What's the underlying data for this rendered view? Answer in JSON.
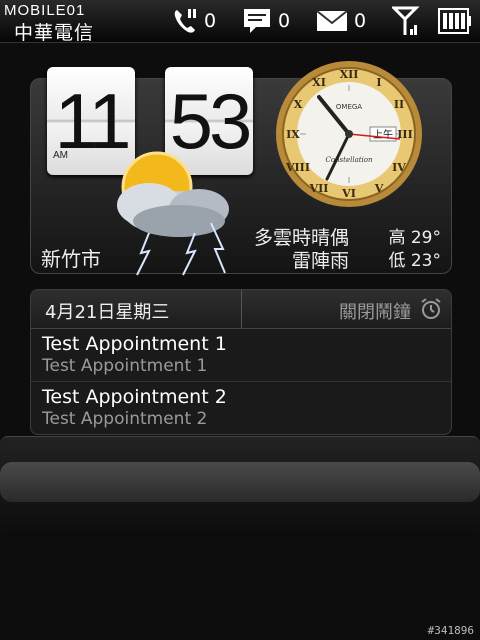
{
  "status_bar": {
    "watermark_brand": "MOBILE01",
    "carrier": "中華電信",
    "missed_calls": "0",
    "messages": "0",
    "emails": "0"
  },
  "clock": {
    "hour": "11",
    "minute": "53",
    "ampm": "AM",
    "analog_brand": "OMEGA",
    "analog_model": "Constellation",
    "analog_ampm": "上午"
  },
  "weather": {
    "city": "新竹市",
    "condition_line1": "多雲時晴偶",
    "condition_line2": "雷陣雨",
    "high_label": "高",
    "high_temp": "29°",
    "low_label": "低",
    "low_temp": "23°"
  },
  "calendar": {
    "date": "4月21日星期三",
    "alarm_label": "關閉鬧鐘",
    "appointments": [
      {
        "title": "Test Appointment 1",
        "subtitle": "Test Appointment 1"
      },
      {
        "title": "Test Appointment 2",
        "subtitle": "Test Appointment 2"
      }
    ]
  },
  "watermark_id": "#341896"
}
